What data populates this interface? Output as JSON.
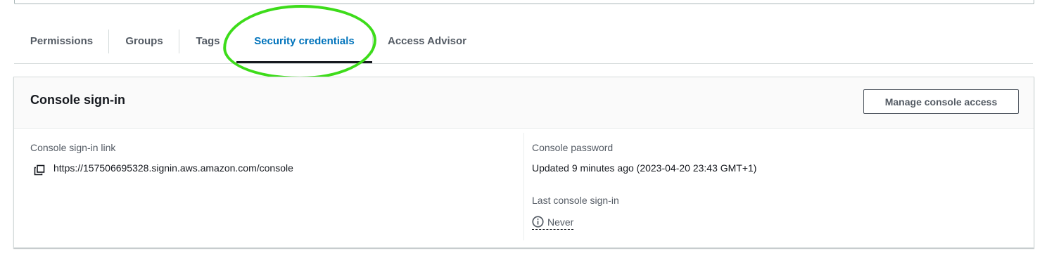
{
  "tabs": [
    {
      "label": "Permissions"
    },
    {
      "label": "Groups"
    },
    {
      "label": "Tags"
    },
    {
      "label": "Security credentials",
      "active": true
    },
    {
      "label": "Access Advisor"
    }
  ],
  "console_signin": {
    "title": "Console sign-in",
    "manage_button": "Manage console access",
    "link_label": "Console sign-in link",
    "link_value": "https://157506695328.signin.aws.amazon.com/console",
    "password_label": "Console password",
    "password_value": "Updated 9 minutes ago (2023-04-20 23:43 GMT+1)",
    "last_signin_label": "Last console sign-in",
    "last_signin_value": "Never"
  },
  "icons": {
    "copy": "copy-icon",
    "info": "info-icon"
  },
  "colors": {
    "active_tab": "#0073bb",
    "highlight": "#3ddc1a"
  }
}
